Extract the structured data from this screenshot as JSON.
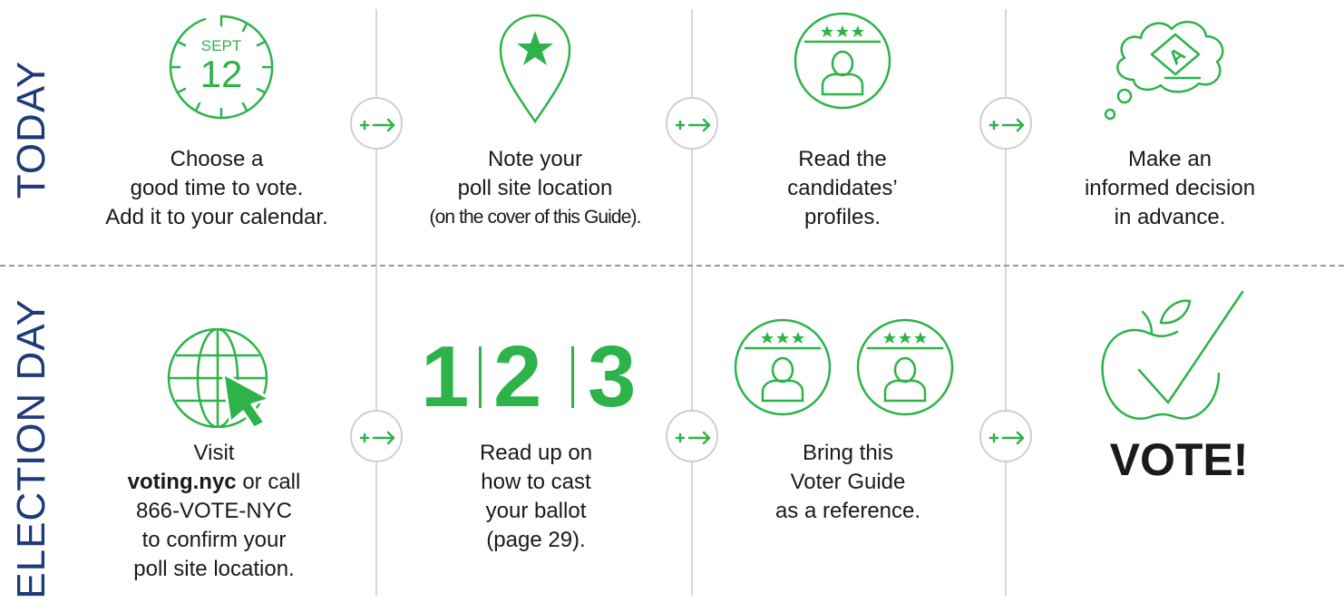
{
  "row_labels": {
    "today": "TODAY",
    "election_day": "ELECTION DAY"
  },
  "today": {
    "calendar_icon": {
      "month": "SEPT",
      "day": "12"
    },
    "step1": {
      "line1": "Choose a",
      "line2": "good time to vote.",
      "line3": "Add it to your calendar."
    },
    "step2": {
      "line1": "Note your",
      "line2": "poll site location",
      "line3": "(on the cover of this Guide)."
    },
    "step3": {
      "line1": "Read the",
      "line2": "candidates’",
      "line3": "profiles."
    },
    "step4": {
      "line1": "Make an",
      "line2": "informed decision",
      "line3": "in advance."
    }
  },
  "election_day": {
    "step1": {
      "line1": "Visit",
      "link": "voting.nyc",
      "line2_rest": " or call",
      "line3": "866-VOTE-NYC",
      "line4": "to confirm your",
      "line5": "poll site location."
    },
    "step2": {
      "numbers": [
        "1",
        "2",
        "3"
      ],
      "line1": "Read up on",
      "line2": "how to cast",
      "line3": "your ballot",
      "line4": "(page 29)."
    },
    "step3": {
      "line1": "Bring this",
      "line2": "Voter Guide",
      "line3": "as a reference."
    },
    "step4": {
      "vote": "VOTE!"
    }
  },
  "icons": {
    "calendar": "clock-calendar-icon",
    "location": "map-pin-star-icon",
    "candidate": "candidate-profile-icon",
    "decision": "thought-bubble-ballot-icon",
    "globe": "globe-cursor-icon",
    "guide": "two-candidate-profiles-icon",
    "vote": "apple-checkmark-icon",
    "arrow": "plus-arrow-icon"
  },
  "colors": {
    "accent": "#2db34a",
    "row_label": "#1e3a78",
    "text": "#1a1a1a"
  }
}
